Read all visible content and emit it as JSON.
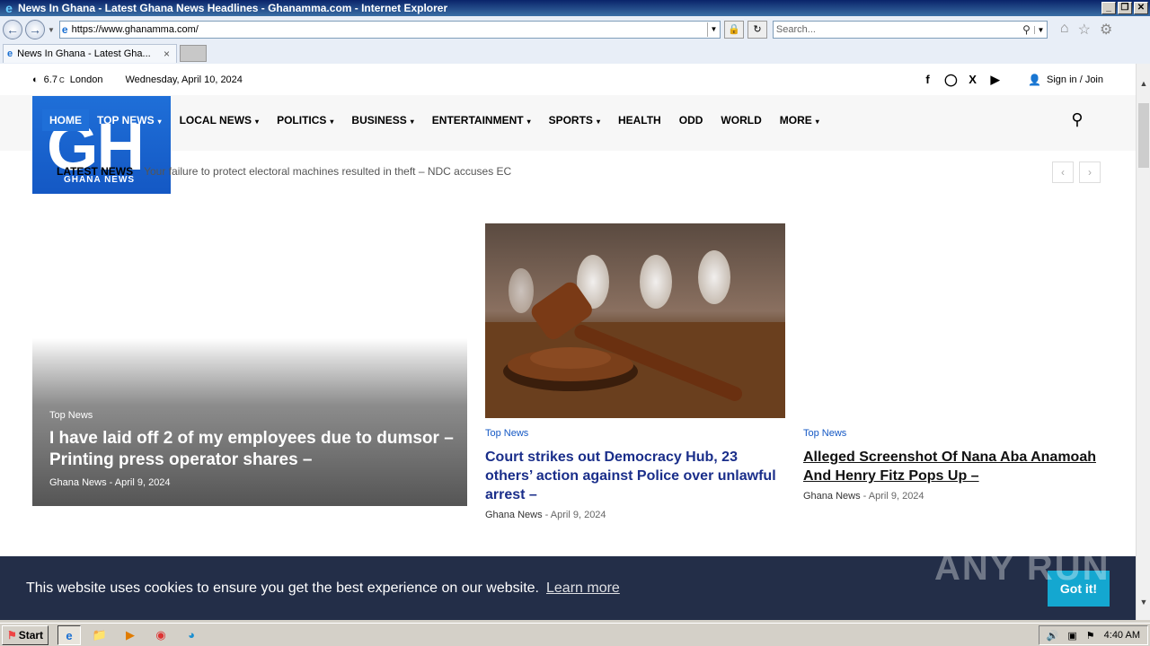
{
  "window": {
    "title": "News In Ghana - Latest Ghana News Headlines - Ghanamma.com - Internet Explorer",
    "buttons": {
      "min": "_",
      "restore": "❐",
      "close": "✕"
    }
  },
  "browser": {
    "url": "https://www.ghanamma.com/",
    "search_placeholder": "Search...",
    "tab_title": "News In Ghana - Latest Gha...",
    "tab_close": "×"
  },
  "topbar": {
    "temp": "6.7",
    "unit": "C",
    "city": "London",
    "date": "Wednesday, April 10, 2024",
    "signin": "Sign in / Join",
    "social_icons": [
      "facebook-icon",
      "instagram-icon",
      "x-icon",
      "youtube-icon"
    ]
  },
  "logo": {
    "big": "GH",
    "small": "GHANA NEWS"
  },
  "menu": {
    "items": [
      {
        "label": "HOME"
      },
      {
        "label": "TOP NEWS"
      },
      {
        "label": "LOCAL NEWS"
      },
      {
        "label": "POLITICS"
      },
      {
        "label": "BUSINESS"
      },
      {
        "label": "ENTERTAINMENT"
      },
      {
        "label": "SPORTS"
      },
      {
        "label": "HEALTH"
      },
      {
        "label": "ODD"
      },
      {
        "label": "WORLD"
      },
      {
        "label": "MORE"
      }
    ]
  },
  "ticker": {
    "label": "LATEST NEWS",
    "text": "Your failure to protect electoral machines resulted in theft – NDC accuses EC"
  },
  "featured": {
    "category": "Top News",
    "title": "I have laid off 2 of my employees due to dumsor – Printing press operator shares –",
    "author": "Ghana News",
    "sep": "-",
    "date": "April 9, 2024"
  },
  "cards": [
    {
      "category": "Top News",
      "title": "Court strikes out Democracy Hub, 23 others’ action against Police over unlawful arrest –",
      "author": "Ghana News",
      "sep": "-",
      "date": "April 9, 2024"
    },
    {
      "category": "Top News",
      "title": "Alleged Screenshot Of Nana Aba Anamoah And Henry Fitz Pops Up –",
      "author": "Ghana News",
      "sep": "-",
      "date": "April 9, 2024"
    }
  ],
  "cookie": {
    "message": "This website uses cookies to ensure you get the best experience on our website.",
    "learn_more": "Learn more",
    "accept": "Got it!"
  },
  "watermark": "ANY RUN",
  "taskbar": {
    "start": "Start",
    "clock": "4:40 AM"
  },
  "colors": {
    "brand_blue": "#1f6fd8",
    "headline_navy": "#1a2e8a",
    "cookie_bg": "#232e48",
    "accept_btn": "#14a7d0"
  }
}
